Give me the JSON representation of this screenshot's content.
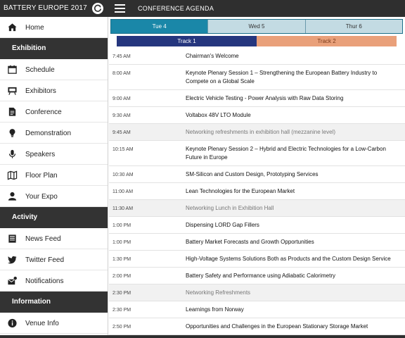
{
  "header": {
    "app_title": "BATTERY EUROPE 2017",
    "page_title": "CONFERENCE AGENDA"
  },
  "sidebar": {
    "items": [
      {
        "type": "item",
        "label": "Home",
        "icon": "home-icon"
      },
      {
        "type": "section",
        "label": "Exhibition"
      },
      {
        "type": "item",
        "label": "Schedule",
        "icon": "calendar-icon"
      },
      {
        "type": "item",
        "label": "Exhibitors",
        "icon": "easel-icon"
      },
      {
        "type": "item",
        "label": "Conference",
        "icon": "document-icon"
      },
      {
        "type": "item",
        "label": "Demonstration",
        "icon": "lightbulb-icon"
      },
      {
        "type": "item",
        "label": "Speakers",
        "icon": "microphone-icon"
      },
      {
        "type": "item",
        "label": "Floor Plan",
        "icon": "map-icon"
      },
      {
        "type": "item",
        "label": "Your Expo",
        "icon": "user-icon"
      },
      {
        "type": "section",
        "label": "Activity"
      },
      {
        "type": "item",
        "label": "News Feed",
        "icon": "newspaper-icon"
      },
      {
        "type": "item",
        "label": "Twitter Feed",
        "icon": "twitter-icon"
      },
      {
        "type": "item",
        "label": "Notifications",
        "icon": "notification-icon"
      },
      {
        "type": "section",
        "label": "Information"
      },
      {
        "type": "item",
        "label": "Venue Info",
        "icon": "info-icon"
      }
    ]
  },
  "days": {
    "tabs": [
      "Tue 4",
      "Wed 5",
      "Thur 6"
    ],
    "active": 0
  },
  "tracks": {
    "tabs": [
      "Track 1",
      "Track 2"
    ],
    "active": 0,
    "colors": {
      "track1": "#25367e",
      "track2": "#e9a07a"
    }
  },
  "agenda": [
    {
      "time": "7:45 AM",
      "title": "Chairman's Welcome",
      "break": false
    },
    {
      "time": "8:00 AM",
      "title": "Keynote Plenary Session 1 – Strengthening the European Battery Industry to Compete on a Global Scale",
      "break": false
    },
    {
      "time": "9:00 AM",
      "title": "Electric Vehicle Testing - Power Analysis with Raw Data Storing",
      "break": false
    },
    {
      "time": "9:30 AM",
      "title": "Voltabox 48V LTO Module",
      "break": false
    },
    {
      "time": "9:45 AM",
      "title": "Networking refreshments in exhibition hall (mezzanine level)",
      "break": true
    },
    {
      "time": "10:15 AM",
      "title": "Keynote Plenary Session 2 – Hybrid and Electric Technologies for a Low-Carbon Future in Europe",
      "break": false
    },
    {
      "time": "10:30 AM",
      "title": "SM-Silicon and Custom Design, Prototyping Services",
      "break": false
    },
    {
      "time": "11:00 AM",
      "title": "Lean Technologies for the European Market",
      "break": false
    },
    {
      "time": "11:30 AM",
      "title": "Networking Lunch in Exhibition Hall",
      "break": true
    },
    {
      "time": "1:00 PM",
      "title": "Dispensing LORD Gap Fillers",
      "break": false
    },
    {
      "time": "1:00 PM",
      "title": "Battery Market Forecasts and Growth Opportunities",
      "break": false
    },
    {
      "time": "1:30 PM",
      "title": "High-Voltage Systems Solutions Both as Products and the Custom Design Service",
      "break": false
    },
    {
      "time": "2:00 PM",
      "title": "Battery Safety and Performance using Adiabatic Calorimetry",
      "break": false
    },
    {
      "time": "2:30 PM",
      "title": "Networking Refreshments",
      "break": true
    },
    {
      "time": "2:30 PM",
      "title": "Learnings from Norway",
      "break": false
    },
    {
      "time": "2:50 PM",
      "title": "Opportunities and Challenges in the European Stationary Storage Market",
      "break": false
    }
  ]
}
